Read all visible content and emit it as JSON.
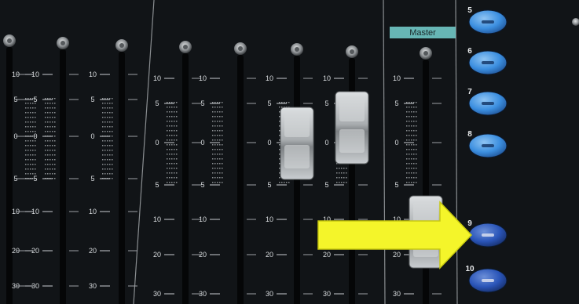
{
  "master_label": "Master",
  "scale_labels": [
    "10",
    "5",
    "0",
    "5",
    "10",
    "20",
    "30"
  ],
  "button_numbers": [
    "5",
    "6",
    "7",
    "8",
    "9",
    "10"
  ],
  "colors": {
    "panel": "#111417",
    "master_strip": "#67b6b5",
    "button_blue": "#3c8fe0",
    "button_dark_blue": "#2a55b8",
    "fader_cap": "#b9bdc0",
    "arrow": "#f4f52a"
  },
  "annotation": {
    "type": "arrow",
    "points_to_button": "9"
  }
}
